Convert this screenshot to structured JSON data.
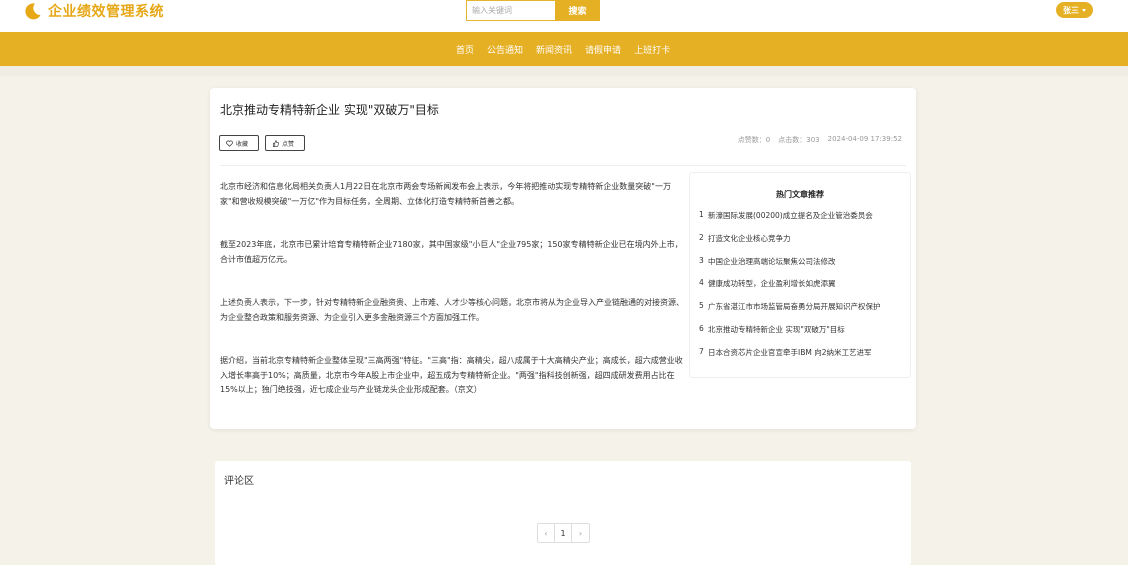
{
  "header": {
    "app_title": "企业绩效管理系统",
    "search_placeholder": "输入关键词",
    "search_button": "搜索",
    "user_name": "张三"
  },
  "nav": {
    "items": [
      "首页",
      "公告通知",
      "新闻资讯",
      "请假申请",
      "上班打卡"
    ]
  },
  "article": {
    "title": "北京推动专精特新企业 实现\"双破万\"目标",
    "favorite_label": "收藏",
    "like_label": "点赞",
    "likes": "点赞数：0",
    "clicks": "点击数：303",
    "datetime": "2024-04-09 17:39:52",
    "paragraphs": [
      "北京市经济和信息化局相关负责人1月22日在北京市两会专场新闻发布会上表示，今年将把推动实现专精特新企业数量突破\"一万家\"和营收规模突破\"一万亿\"作为目标任务，全周期、立体化打造专精特新首善之都。",
      "截至2023年底，北京市已累计培育专精特新企业7180家，其中国家级\"小巨人\"企业795家；150家专精特新企业已在境内外上市，合计市值超万亿元。",
      "上述负责人表示，下一步，针对专精特新企业融资贵、上市难、人才少等核心问题，北京市将从为企业导入产业链融通的对接资源、为企业整合政策和服务资源、为企业引入更多金融资源三个方面加强工作。",
      "据介绍，当前北京专精特新企业整体呈现\"三高两强\"特征。\"三高\"指：高精尖，超八成属于十大高精尖产业；高成长，超六成营业收入增长率高于10%；高质量，北京市今年A股上市企业中，超五成为专精特新企业。\"两强\"指科技创新强，超四成研发费用占比在15%以上；独门绝技强，近七成企业与产业链龙头企业形成配套。（京文）"
    ]
  },
  "hot": {
    "title": "热门文章推荐",
    "items": [
      {
        "num": "1",
        "text": "新濠国际发展(00200)成立提名及企业管治委员会"
      },
      {
        "num": "2",
        "text": "打造文化企业核心竞争力"
      },
      {
        "num": "3",
        "text": "中国企业治理高端论坛聚焦公司法修改"
      },
      {
        "num": "4",
        "text": "健康成功转型，企业盈利增长如虎添翼"
      },
      {
        "num": "5",
        "text": "广东省湛江市市场监管局奋勇分局开展知识产权保护"
      },
      {
        "num": "6",
        "text": "北京推动专精特新企业 实现\"双破万\"目标"
      },
      {
        "num": "7",
        "text": "日本合资芯片企业官宣牵手IBM 向2纳米工艺进军"
      }
    ]
  },
  "comments": {
    "title": "评论区",
    "prev": "‹",
    "page": "1",
    "next": "›"
  },
  "colors": {
    "accent": "#e6b024",
    "background": "#f5f3e9"
  }
}
